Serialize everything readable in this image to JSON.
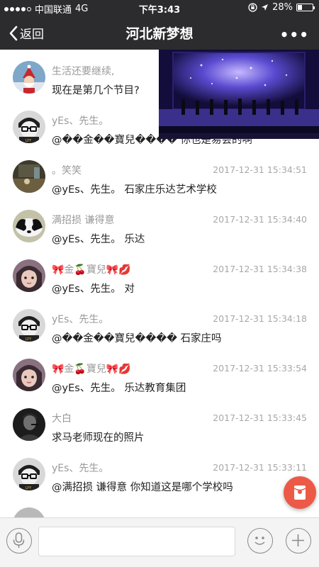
{
  "status_bar": {
    "carrier": "中国联通",
    "network": "4G",
    "time": "下午3:43",
    "battery_percent": "28%",
    "battery_level": 0.28
  },
  "nav": {
    "back_label": "返回",
    "title": "河北新梦想",
    "more_label": "•••"
  },
  "messages": [
    {
      "name": "生活还要继续,",
      "time": "",
      "text": "现在是第几个节目?",
      "avatar": "santa-avatar"
    },
    {
      "name": "yEs、先生。",
      "time": "",
      "text": "@��金��寶兒���� 你也是易会的啊",
      "avatar": "cartoon-glasses-avatar"
    },
    {
      "name": "。笑笑",
      "time": "2017-12-31 15:34:51",
      "text": "@yEs、先生。 石家庄乐达艺术学校",
      "avatar": "dark-photo-avatar"
    },
    {
      "name": "满招损 谦得意",
      "time": "2017-12-31 15:34:40",
      "text": "@yEs、先生。 乐达",
      "avatar": "panda-avatar"
    },
    {
      "name": "🎀金🍒寶兒🎀💋",
      "time": "2017-12-31 15:34:38",
      "text": "@yEs、先生。 对",
      "avatar": "girl-avatar"
    },
    {
      "name": "yEs、先生。",
      "time": "2017-12-31 15:34:18",
      "text": "@��金��寶兒���� 石家庄吗",
      "avatar": "cartoon-glasses-avatar"
    },
    {
      "name": "🎀金🍒寶兒🎀💋",
      "time": "2017-12-31 15:33:54",
      "text": "@yEs、先生。 乐达教育集团",
      "avatar": "girl-avatar"
    },
    {
      "name": "大白",
      "time": "2017-12-31 15:33:45",
      "text": "求马老师现在的照片",
      "avatar": "bw-portrait-avatar"
    },
    {
      "name": "yEs、先生。",
      "time": "2017-12-31 15:33:11",
      "text": "@满招损 谦得意 你知道这是哪个学校吗",
      "avatar": "cartoon-glasses-avatar"
    }
  ],
  "colors": {
    "nav_bg": "#2c2c2e",
    "name_gray": "#9a9a9a",
    "red_packet": "#ec5a47"
  }
}
